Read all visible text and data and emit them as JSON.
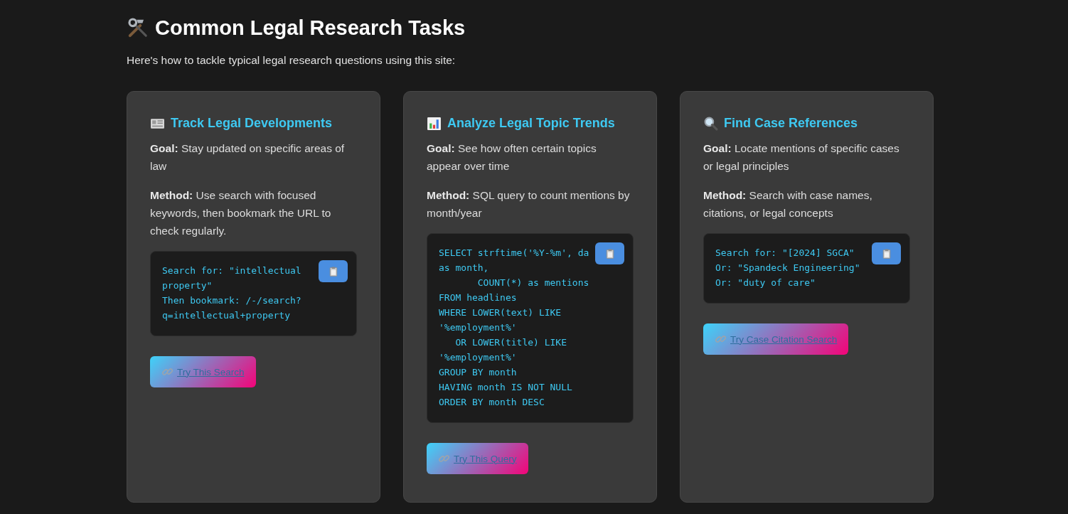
{
  "heading": {
    "title": "Common Legal Research Tasks",
    "subtitle": "Here's how to tackle typical legal research questions using this site:"
  },
  "cards": [
    {
      "kind": "newspaper",
      "title": "Track Legal Developments",
      "goal": "**Goal:** Stay updated on specific areas of law",
      "method": "**Method:** Use search with focused keywords, then bookmark the URL to check regularly.",
      "code": "Search for: \"intellectual\nproperty\"\nThen bookmark: /-/search?\nq=intellectual+property",
      "action": "Try This Search"
    },
    {
      "kind": "chart",
      "title": "Analyze Legal Topic Trends",
      "goal": "**Goal:** See how often certain topics appear over time",
      "method": "**Method:** SQL query to count mentions by month/year",
      "code": "SELECT strftime('%Y-%m', da\nas month,\n       COUNT(*) as mentions\nFROM headlines\nWHERE LOWER(text) LIKE\n'%employment%'\n   OR LOWER(title) LIKE\n'%employment%'\nGROUP BY month\nHAVING month IS NOT NULL\nORDER BY month DESC",
      "action": "Try This Query"
    },
    {
      "kind": "magnifier",
      "title": "Find Case References",
      "goal": "**Goal:** Locate mentions of specific cases or legal principles",
      "method": "**Method:** Search with case names, citations, or legal concepts",
      "code": "Search for: \"[2024] SGCA\"\nOr: \"Spandeck Engineering\"\nOr: \"duty of care\"",
      "action": "Try Case Citation Search"
    }
  ]
}
